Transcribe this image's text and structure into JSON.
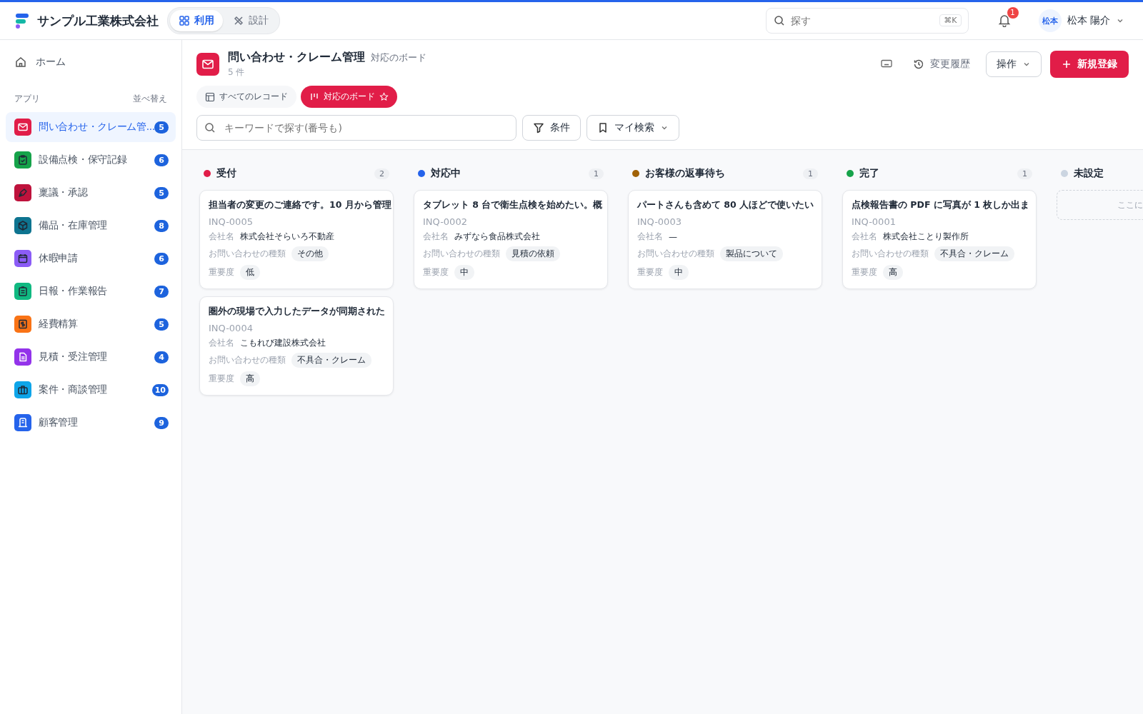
{
  "brand": {
    "name": "サンプル工業株式会社"
  },
  "mode_tabs": [
    {
      "label": "利用",
      "selected": true
    },
    {
      "label": "設計",
      "selected": false
    }
  ],
  "search": {
    "placeholder": "探す",
    "shortcut": "⌘K"
  },
  "notifications": {
    "count": "1"
  },
  "user": {
    "avatar": "松本",
    "name": "松本 陽介"
  },
  "sidebar": {
    "home": "ホーム",
    "section": "アプリ",
    "sort": "並べ替え",
    "items": [
      {
        "label": "問い合わせ・クレーム管...",
        "count": "5",
        "color": "#e11d48",
        "selected": true
      },
      {
        "label": "設備点検・保守記録",
        "count": "6",
        "color": "#16a34a",
        "selected": false
      },
      {
        "label": "稟議・承認",
        "count": "5",
        "color": "#be123c",
        "selected": false
      },
      {
        "label": "備品・在庫管理",
        "count": "8",
        "color": "#0e7490",
        "selected": false
      },
      {
        "label": "休暇申請",
        "count": "6",
        "color": "#8b5cf6",
        "selected": false
      },
      {
        "label": "日報・作業報告",
        "count": "7",
        "color": "#10b981",
        "selected": false
      },
      {
        "label": "経費精算",
        "count": "5",
        "color": "#f97316",
        "selected": false
      },
      {
        "label": "見積・受注管理",
        "count": "4",
        "color": "#9333ea",
        "selected": false
      },
      {
        "label": "案件・商談管理",
        "count": "10",
        "color": "#0ea5e9",
        "selected": false
      },
      {
        "label": "顧客管理",
        "count": "9",
        "color": "#2563eb",
        "selected": false
      }
    ]
  },
  "page": {
    "title": "問い合わせ・クレーム管理",
    "view_name": "対応のボード",
    "record_count": "5 件",
    "history": "変更履歴",
    "actions": "操作",
    "new": "新規登録"
  },
  "views": [
    {
      "label": "すべてのレコード",
      "kind": "table",
      "selected": false
    },
    {
      "label": "対応のボード",
      "kind": "board",
      "selected": true
    }
  ],
  "filter": {
    "placeholder": "キーワードで探す(番号も)",
    "conditions": "条件",
    "saved": "マイ検索"
  },
  "columns": [
    {
      "name": "受付",
      "count": "2",
      "color": "#e11d48",
      "cards": [
        {
          "title": "担当者の変更のご連絡です。10 月から管理",
          "id": "INQ-0005",
          "company_label": "会社名",
          "company": "株式会社そらいろ不動産",
          "type_label": "お問い合わせの種類",
          "type": "その他",
          "priority_label": "重要度",
          "priority": "低"
        },
        {
          "title": "圏外の現場で入力したデータが同期された",
          "id": "INQ-0004",
          "company_label": "会社名",
          "company": "こもれび建設株式会社",
          "type_label": "お問い合わせの種類",
          "type": "不具合・クレーム",
          "priority_label": "重要度",
          "priority": "高"
        }
      ]
    },
    {
      "name": "対応中",
      "count": "1",
      "color": "#2563eb",
      "cards": [
        {
          "title": "タブレット 8 台で衛生点検を始めたい。概",
          "id": "INQ-0002",
          "company_label": "会社名",
          "company": "みずなら食品株式会社",
          "type_label": "お問い合わせの種類",
          "type": "見積の依頼",
          "priority_label": "重要度",
          "priority": "中"
        }
      ]
    },
    {
      "name": "お客様の返事待ち",
      "count": "1",
      "color": "#a16207",
      "cards": [
        {
          "title": "パートさんも含めて 80 人ほどで使いたい",
          "id": "INQ-0003",
          "company_label": "会社名",
          "company": "—",
          "type_label": "お問い合わせの種類",
          "type": "製品について",
          "priority_label": "重要度",
          "priority": "中"
        }
      ]
    },
    {
      "name": "完了",
      "count": "1",
      "color": "#16a34a",
      "cards": [
        {
          "title": "点検報告書の PDF に写真が 1 枚しか出ま",
          "id": "INQ-0001",
          "company_label": "会社名",
          "company": "株式会社ことり製作所",
          "type_label": "お問い合わせの種類",
          "type": "不具合・クレーム",
          "priority_label": "重要度",
          "priority": "高"
        }
      ]
    },
    {
      "name": "未設定",
      "color": "#cbd5e1",
      "empty_hint": "ここに"
    }
  ]
}
